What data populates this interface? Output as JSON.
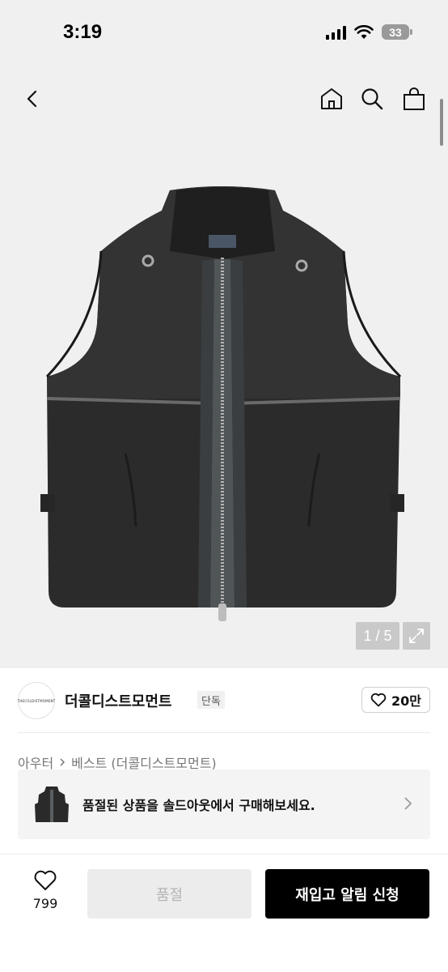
{
  "status_bar": {
    "time": "3:19",
    "battery": "33",
    "icons": [
      "signal-icon",
      "wifi-icon",
      "battery-icon"
    ]
  },
  "nav": {
    "icons": [
      "back-icon",
      "home-icon",
      "search-icon",
      "shopping-bag-icon"
    ]
  },
  "gallery": {
    "counter": "1 / 5",
    "icons": [
      "expand-icon"
    ]
  },
  "brand": {
    "logo_text": "THECOLDISTMOMENT",
    "name": "더콜디스트모먼트",
    "tag": "단독",
    "like_count": "20만"
  },
  "breadcrumb": {
    "category": "아우터",
    "subcategory": "베스트 (더콜디스트모먼트)"
  },
  "soldout_banner": {
    "text": "품절된 상품을 솔드아웃에서 구매해보세요."
  },
  "bottom_bar": {
    "like_count": "799",
    "soldout_label": "품절",
    "restock_label": "재입고 알림 신청"
  },
  "colors": {
    "accent": "#000000",
    "background": "#f0f0f0",
    "disabled": "#ececec"
  }
}
